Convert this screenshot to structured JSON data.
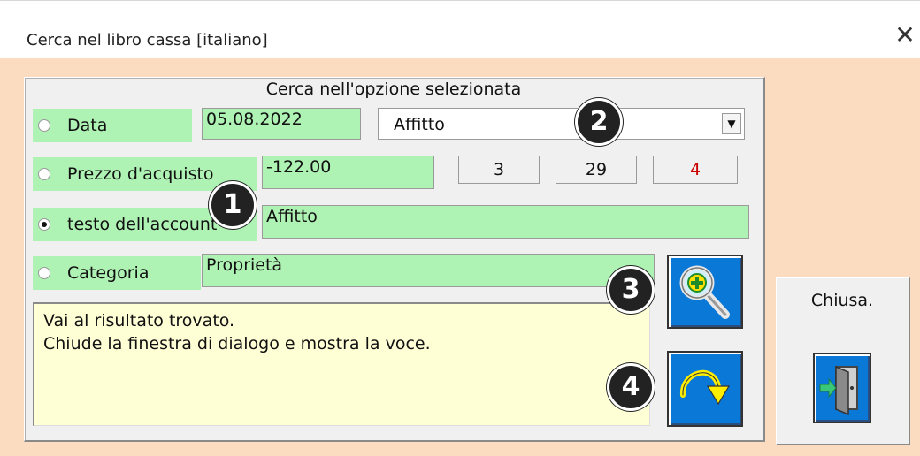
{
  "window": {
    "title": "Cerca nel libro cassa [italiano]",
    "close_glyph": "✕"
  },
  "frame": {
    "caption": "Cerca nell'opzione selezionata"
  },
  "options": [
    {
      "label": "Data",
      "value": "05.08.2022",
      "selected": false
    },
    {
      "label": "Prezzo d'acquisto",
      "value": "-122.00",
      "selected": false
    },
    {
      "label": "testo dell'account",
      "value": "Affitto",
      "selected": true
    },
    {
      "label": "Categoria",
      "value": "Proprietà",
      "selected": false
    }
  ],
  "combo": {
    "value": "Affitto",
    "arrow": "▼"
  },
  "counters": [
    {
      "value": "3",
      "color": "#111111"
    },
    {
      "value": "29",
      "color": "#111111"
    },
    {
      "value": "4",
      "color": "#cc0000"
    }
  ],
  "info": {
    "line1": "Vai al risultato trovato.",
    "line2": "Chiude la finestra di dialogo e mostra la voce."
  },
  "badges": [
    "1",
    "2",
    "3",
    "4"
  ],
  "buttons": {
    "search_icon": "magnifier-plus-icon",
    "goto_icon": "curved-arrow-icon",
    "close_icon": "door-exit-icon",
    "close_label": "Chiusa."
  },
  "colors": {
    "field_green": "#aef2b4",
    "background": "#fcdcc0",
    "button_blue": "#0a78d7",
    "info_yellow": "#ffffd6"
  }
}
